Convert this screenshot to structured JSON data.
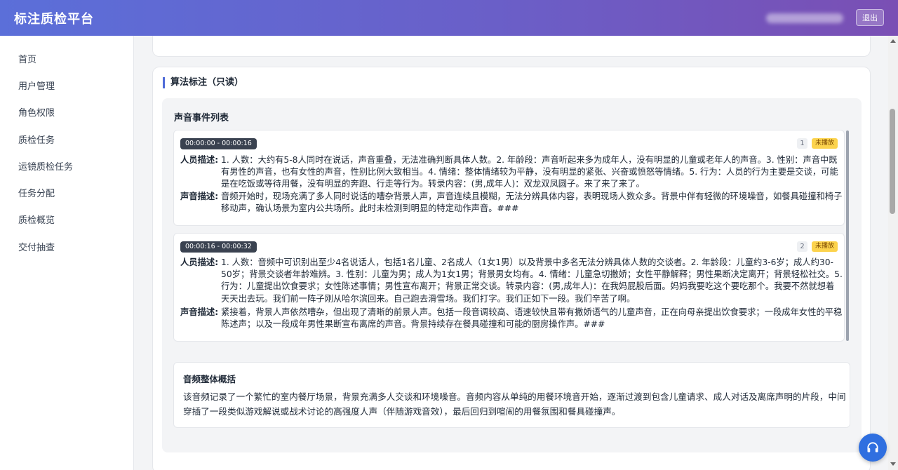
{
  "header": {
    "app_title": "标注质检平台",
    "logout_label": "退出"
  },
  "sidebar": {
    "items": [
      {
        "label": "首页"
      },
      {
        "label": "用户管理"
      },
      {
        "label": "角色权限"
      },
      {
        "label": "质检任务"
      },
      {
        "label": "运镜质检任务"
      },
      {
        "label": "任务分配"
      },
      {
        "label": "质检概览"
      },
      {
        "label": "交付抽查"
      }
    ]
  },
  "algo_section": {
    "title": "算法标注（只读）",
    "event_list_title": "声音事件列表",
    "labels": {
      "person": "人员描述:",
      "sound": "声音描述:"
    },
    "events": [
      {
        "time_range": "00:00:00 - 00:00:16",
        "index": "1",
        "status": "未播放",
        "person_desc": "1. 人数：大约有5-8人同时在说话，声音重叠，无法准确判断具体人数。2. 年龄段：声音听起来多为成年人，没有明显的儿童或老年人的声音。3. 性别：声音中既有男性的声音，也有女性的声音，性别比例大致相当。4. 情绪：整体情绪较为平静，没有明显的紧张、兴奋或愤怒等情绪。5. 行为：人员的行为主要是交谈，可能是在吃饭或等待用餐，没有明显的奔跑、行走等行为。转录内容：(男,成年人)：双龙双凤圆子。来了来了来了。",
        "sound_desc": "音频开始时，现场充满了多人同时说话的嘈杂背景人声，声音连续且模糊，无法分辨具体内容，表明现场人数众多。背景中伴有轻微的环境噪音，如餐具碰撞和椅子移动声，确认场景为室内公共场所。此时未检测到明显的特定动作声音。###"
      },
      {
        "time_range": "00:00:16 - 00:00:32",
        "index": "2",
        "status": "未播放",
        "person_desc": "1. 人数：音频中可识别出至少4名说话人，包括1名儿童、2名成人（1女1男）以及背景中多名无法分辨具体人数的交谈者。2. 年龄段：儿童约3-6岁；成人约30-50岁；背景交谈者年龄难辨。3. 性别：儿童为男；成人为1女1男；背景男女均有。4. 情绪：儿童急切撒娇；女性平静解释；男性果断决定离开；背景轻松社交。5. 行为：儿童提出饮食要求；女性陈述事情；男性宣布离开；背景正常交谈。转录内容：(男,成年人)：在我妈屁股后面。妈妈我要吃这个要吃那个。我要不然就想着天天出去玩。我们前一阵子刚从哈尔滨回来。自己跑去滑雪场。我们打字。我们正如下一段。我们辛苦了啊。",
        "sound_desc": "紧接着，背景人声依然嘈杂，但出现了清晰的前景人声。包括一段音调较高、语速较快且带有撒娇语气的儿童声音，正在向母亲提出饮食要求；一段成年女性的平稳陈述声；以及一段成年男性果断宣布离席的声音。背景持续存在餐具碰撞和可能的厨房操作声。###"
      }
    ],
    "summary": {
      "title": "音频整体概括",
      "text": "该音频记录了一个繁忙的室内餐厅场景，背景充满多人交谈和环境噪音。音频内容从单纯的用餐环境音开始，逐渐过渡到包含儿童请求、成人对话及离席声明的片段，中间穿插了一段类似游戏解说或战术讨论的高强度人声（伴随游戏音效），最后回归到喧闹的用餐氛围和餐具碰撞声。"
    }
  },
  "colors": {
    "header_gradient_start": "#5b6fd9",
    "header_gradient_end": "#7a4fb4",
    "status_badge": "#fcd34d",
    "fab": "#2f6fe0"
  }
}
